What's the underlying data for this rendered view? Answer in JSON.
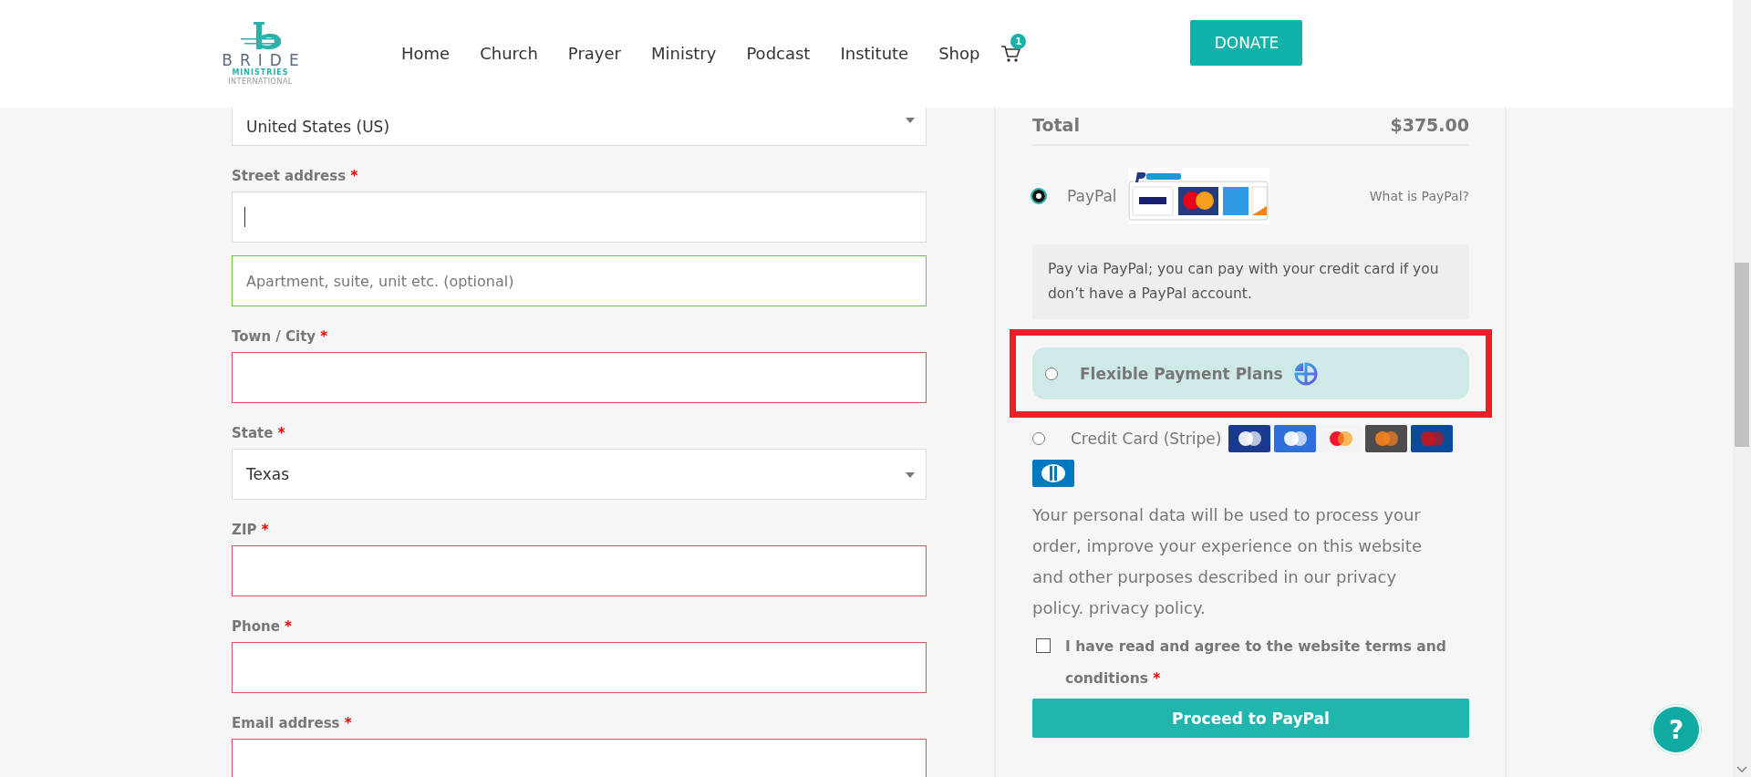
{
  "header": {
    "logo": {
      "title": "BRIDE",
      "subtitle": "MINISTRIES",
      "tagline": "INTERNATIONAL"
    },
    "nav": [
      {
        "label": "Home"
      },
      {
        "label": "Church"
      },
      {
        "label": "Prayer"
      },
      {
        "label": "Ministry"
      },
      {
        "label": "Podcast"
      },
      {
        "label": "Institute"
      },
      {
        "label": "Shop"
      }
    ],
    "cart": {
      "count": "1"
    },
    "donate": "DONATE"
  },
  "billing_fields": [
    {
      "kind": "select",
      "value": "United States (US)",
      "error": false,
      "valid": false
    },
    {
      "kind": "text",
      "label": "Street address",
      "required_mark": "*",
      "focused": true,
      "error": false,
      "valid": false
    },
    {
      "kind": "text",
      "placeholder": "Apartment, suite, unit etc. (optional)",
      "error": false,
      "valid": true
    },
    {
      "kind": "text",
      "label": "Town / City",
      "required_mark": "*",
      "error": true,
      "valid": false
    },
    {
      "kind": "select",
      "label": "State",
      "required_mark": "*",
      "value": "Texas",
      "error": false,
      "valid": false
    },
    {
      "kind": "text",
      "label": "ZIP",
      "required_mark": "*",
      "error": true,
      "valid": false
    },
    {
      "kind": "text",
      "label": "Phone",
      "required_mark": "*",
      "error": true,
      "valid": false
    },
    {
      "kind": "text",
      "label": "Email address",
      "required_mark": "*",
      "error": true,
      "valid": false
    }
  ],
  "order": {
    "total_label": "Total",
    "total": "$375.00"
  },
  "payment_methods": [
    {
      "kind": "paypal",
      "label": "PayPal",
      "selected": true,
      "link": "What is PayPal?",
      "description": "Pay via PayPal; you can pay with your credit card if you don’t have a PayPal account."
    },
    {
      "kind": "plans",
      "label": "Flexible Payment Plans",
      "selected": false,
      "highlighted": true
    },
    {
      "kind": "stripe",
      "label": "Credit Card (Stripe)",
      "selected": false
    }
  ],
  "privacy_text": "Your personal data will be used to process your order, improve your experience on this website and other purposes described in our privacy policy. privacy policy.",
  "terms": {
    "label": "I have read and agree to the website terms and conditions",
    "required_mark": "*",
    "checked": false
  },
  "submit": "Proceed to PayPal",
  "help_button": "?"
}
